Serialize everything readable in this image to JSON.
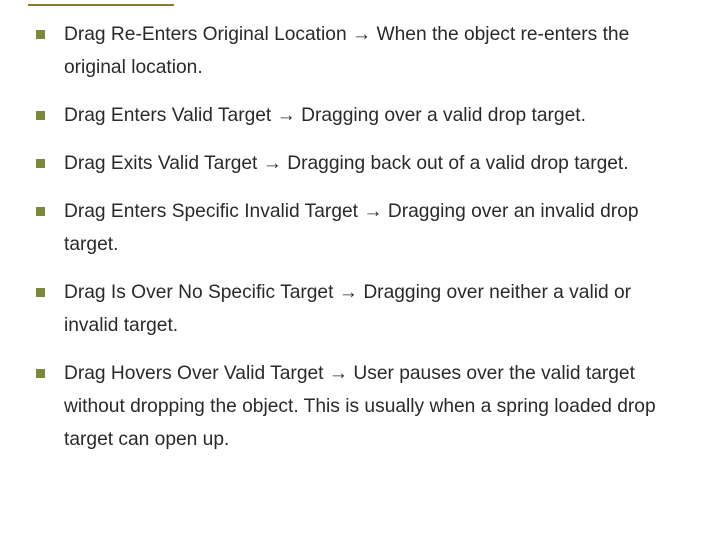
{
  "bullets": [
    {
      "term": "Drag Re-Enters Original Location",
      "arrow": "→",
      "desc": "When the object re-enters the original location."
    },
    {
      "term": "Drag Enters Valid Target",
      "arrow": "→",
      "desc": "Dragging over a valid drop target."
    },
    {
      "term": "Drag Exits Valid Target",
      "arrow": "→",
      "desc": "Dragging back out of a valid drop target."
    },
    {
      "term": "Drag Enters Specific Invalid Target",
      "arrow": "→",
      "desc": "Dragging over an invalid drop target."
    },
    {
      "term": "Drag Is Over No Specific Target",
      "arrow": "→",
      "desc": "Dragging over neither a valid or invalid target."
    },
    {
      "term": "Drag Hovers Over Valid Target",
      "arrow": "→",
      "desc": "User pauses over the valid target without dropping the object. This is usually when a spring loaded drop target can open up."
    }
  ]
}
